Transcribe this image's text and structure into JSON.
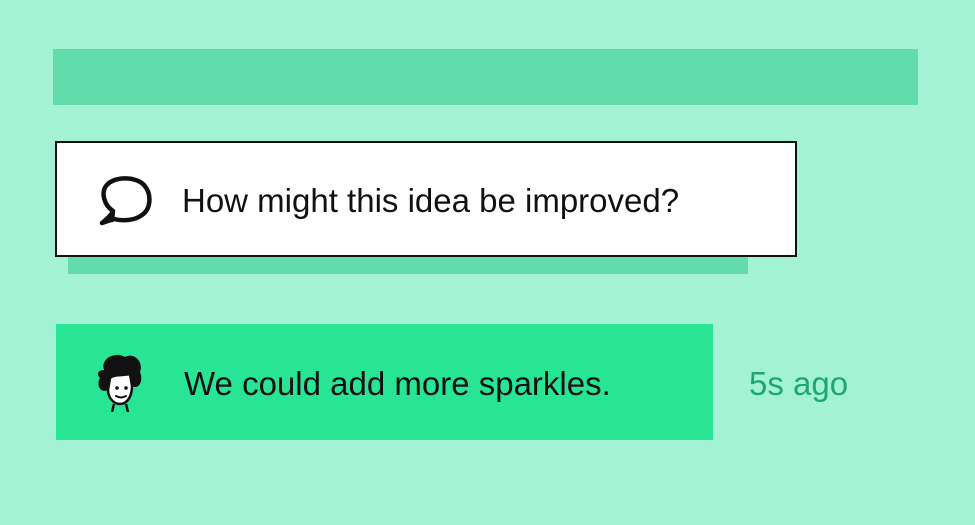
{
  "prompt": {
    "icon": "speech-bubble-icon",
    "text": "How might this idea be improved?"
  },
  "comment": {
    "avatar": "user-avatar-icon",
    "text": "We could add more sparkles.",
    "timestamp": "5s ago"
  },
  "colors": {
    "background": "#a3f2d5",
    "accent_bar": "#63dcac",
    "comment_background": "#28e596",
    "timestamp": "#20a673",
    "text": "#111111"
  }
}
